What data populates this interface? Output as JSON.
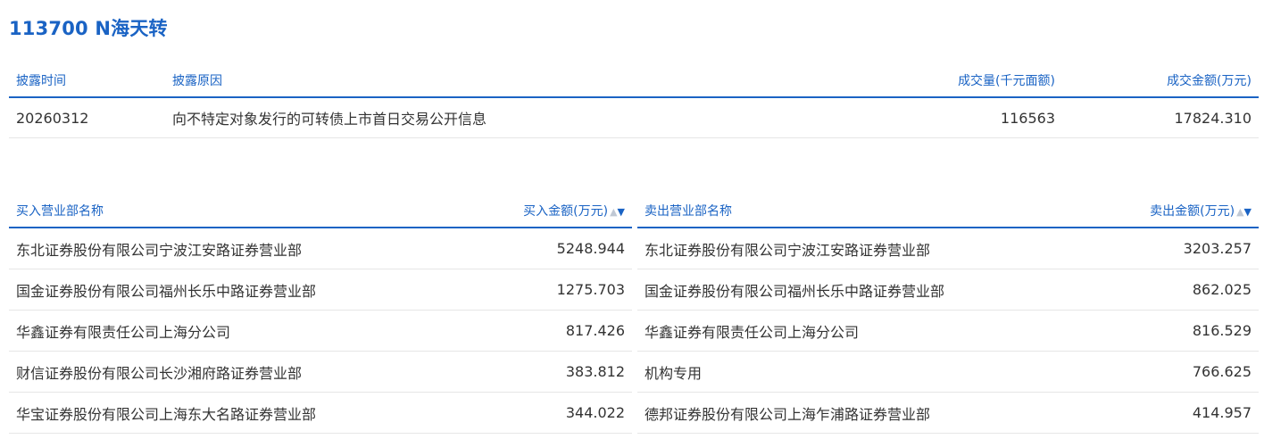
{
  "title": "113700 N海天转",
  "disclosure": {
    "headers": [
      "披露时间",
      "披露原因",
      "成交量(千元面额)",
      "成交金额(万元)"
    ],
    "rows": [
      [
        "20260312",
        "向不特定对象发行的可转债上市首日交易公开信息",
        "116563",
        "17824.310"
      ]
    ]
  },
  "buy": {
    "headers": [
      "买入营业部名称",
      "买入金额(万元)"
    ],
    "rows": [
      [
        "东北证券股份有限公司宁波江安路证券营业部",
        "5248.944"
      ],
      [
        "国金证券股份有限公司福州长乐中路证券营业部",
        "1275.703"
      ],
      [
        "华鑫证券有限责任公司上海分公司",
        "817.426"
      ],
      [
        "财信证券股份有限公司长沙湘府路证券营业部",
        "383.812"
      ],
      [
        "华宝证券股份有限公司上海东大名路证券营业部",
        "344.022"
      ]
    ]
  },
  "sell": {
    "headers": [
      "卖出营业部名称",
      "卖出金额(万元)"
    ],
    "rows": [
      [
        "东北证券股份有限公司宁波江安路证券营业部",
        "3203.257"
      ],
      [
        "国金证券股份有限公司福州长乐中路证券营业部",
        "862.025"
      ],
      [
        "华鑫证券有限责任公司上海分公司",
        "816.529"
      ],
      [
        "机构专用",
        "766.625"
      ],
      [
        "德邦证券股份有限公司上海乍浦路证券营业部",
        "414.957"
      ]
    ]
  },
  "sort_icons": {
    "up": "▲",
    "down": "▼"
  },
  "colors": {
    "accent": "#1a63c4",
    "text": "#333333",
    "row_border": "#e6e6e6"
  }
}
